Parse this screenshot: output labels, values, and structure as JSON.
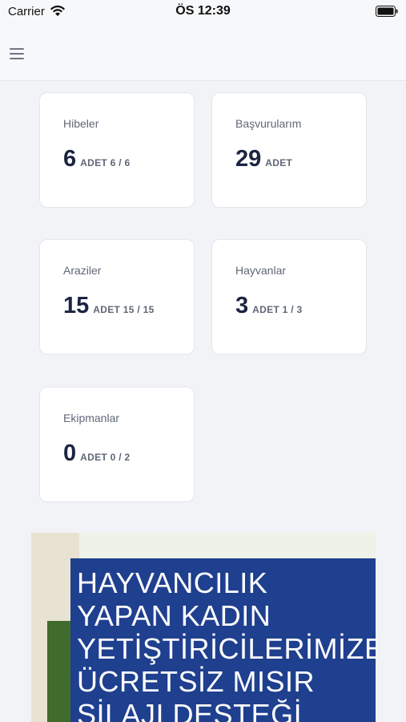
{
  "status_bar": {
    "carrier": "Carrier",
    "time": "ÖS 12:39"
  },
  "cards": [
    {
      "title": "Hibeler",
      "value": "6",
      "unit": "ADET 6 / 6"
    },
    {
      "title": "Başvurularım",
      "value": "29",
      "unit": "ADET"
    },
    {
      "title": "Araziler",
      "value": "15",
      "unit": "ADET 15 / 15"
    },
    {
      "title": "Hayvanlar",
      "value": "3",
      "unit": "ADET 1 / 3"
    },
    {
      "title": "Ekipmanlar",
      "value": "0",
      "unit": "ADET 0 / 2"
    }
  ],
  "banner": {
    "headline": "HAYVANCILIK YAPAN KADIN YETİŞTİRİCİLERİMİZE ÜCRETSİZ MISIR SİLAJI DESTEĞİ"
  }
}
